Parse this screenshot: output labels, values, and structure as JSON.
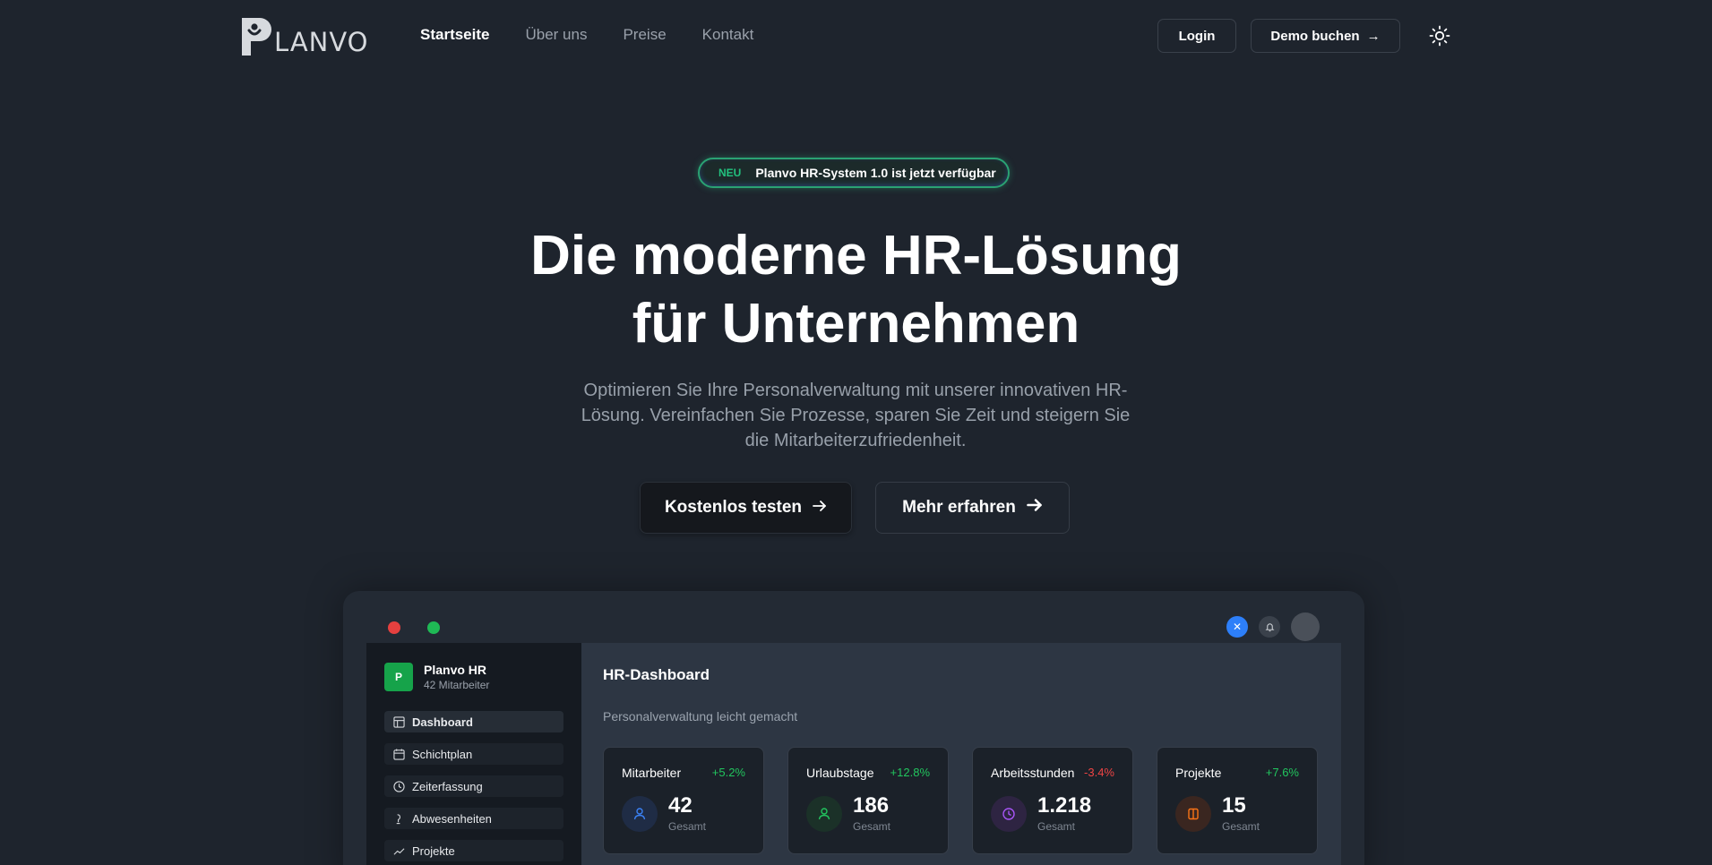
{
  "nav": {
    "logo_text": "LANVO",
    "links": [
      {
        "label": "Startseite",
        "active": true
      },
      {
        "label": "Über uns"
      },
      {
        "label": "Preise"
      },
      {
        "label": "Kontakt"
      }
    ],
    "login_label": "Login",
    "demo_label": "Demo buchen",
    "theme_icon": "sun-icon"
  },
  "hero": {
    "badge_new": "NEU",
    "badge_text": "Planvo HR-System 1.0 ist jetzt verfügbar",
    "title_line1": "Die moderne HR-Lösung",
    "title_line2": "für Unternehmen",
    "subtitle": "Optimieren Sie Ihre Personalverwaltung mit unserer innovativen HR-Lösung. Vereinfachen Sie Prozesse, sparen Sie Zeit und steigern Sie die Mitarbeiterzufriedenheit.",
    "cta_primary": "Kostenlos testen",
    "cta_secondary": "Mehr erfahren"
  },
  "preview": {
    "org_logo": "P",
    "org_name": "Planvo HR",
    "org_count": "42 Mitarbeiter",
    "sidebar": [
      {
        "label": "Dashboard",
        "icon": "dashboard-icon"
      },
      {
        "label": "Schichtplan",
        "icon": "calendar-icon"
      },
      {
        "label": "Zeiterfassung",
        "icon": "clock-icon"
      },
      {
        "label": "Abwesenheiten",
        "icon": "absence-icon"
      },
      {
        "label": "Projekte",
        "icon": "chart-icon"
      }
    ],
    "main_title": "HR-Dashboard",
    "main_sub": "Personalverwaltung leicht gemacht",
    "stats": [
      {
        "label": "Mitarbeiter",
        "change": "+5.2%",
        "value": "42",
        "unit": "Gesamt",
        "color": "#3b82f6"
      },
      {
        "label": "Urlaubstage",
        "change": "+12.8%",
        "value": "186",
        "unit": "Gesamt",
        "color": "#22c55e"
      },
      {
        "label": "Arbeitsstunden",
        "change": "-3.4%",
        "value": "1.218",
        "unit": "Gesamt",
        "color": "#a855f7"
      },
      {
        "label": "Projekte",
        "change": "+7.6%",
        "value": "15",
        "unit": "Gesamt",
        "color": "#f97316"
      }
    ]
  },
  "colors": {
    "background": "#1e242d",
    "accent_green": "#22c55e",
    "negative": "#ef4444",
    "blue": "#2d7ff9"
  }
}
